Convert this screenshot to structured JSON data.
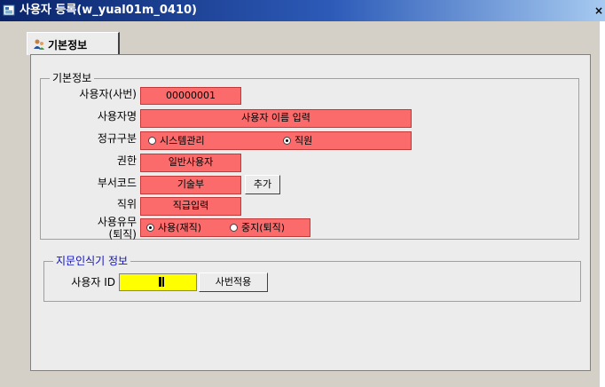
{
  "window": {
    "title": "사용자 등록(w_yual01m_0410)",
    "close_label": "×"
  },
  "tab": {
    "label": "기본정보"
  },
  "basic_group": {
    "caption": "기본정보",
    "user_id_label": "사용자(사번)",
    "user_id_value": "00000001",
    "user_name_label": "사용자명",
    "user_name_value": "사용자 이름 입력",
    "type_label": "정규구분",
    "type_options": [
      "시스템관리",
      "직원"
    ],
    "type_selected": "직원",
    "permission_label": "권한",
    "permission_value": "일반사용자",
    "dept_label": "부서코드",
    "dept_value": "기술부",
    "add_button": "추가",
    "position_label": "직위",
    "position_value": "직급입력",
    "usage_label_line1": "사용유무",
    "usage_label_line2": "(퇴직)",
    "usage_options": [
      "사용(재직)",
      "중지(퇴직)"
    ],
    "usage_selected": "사용(재직)"
  },
  "fingerprint_group": {
    "caption": "지문인식기 정보",
    "user_id_label": "사용자 ID",
    "apply_button": "사번적용"
  },
  "colors": {
    "field_bg": "#fb6b6b",
    "input_focus": "#ffff00",
    "fingerprint_caption": "#1010c0"
  }
}
